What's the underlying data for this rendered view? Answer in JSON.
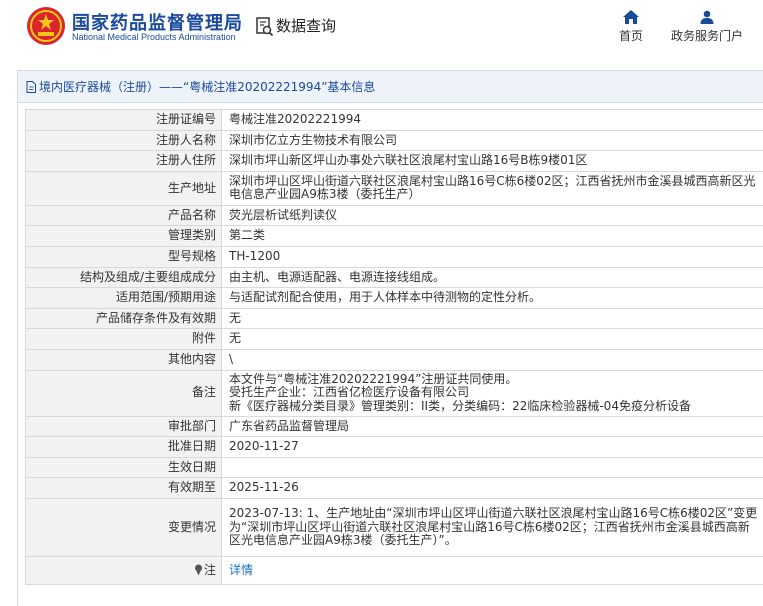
{
  "header": {
    "brand_cn": "国家药品监督管理局",
    "brand_en": "National Medical Products Administration",
    "data_query": "数据查询",
    "nav_home": "首页",
    "nav_portal": "政务服务门户"
  },
  "panel": {
    "title": "境内医疗器械（注册）——“粤械注准20202221994”基本信息"
  },
  "rows": [
    {
      "label": "注册证编号",
      "value": "粤械注准20202221994"
    },
    {
      "label": "注册人名称",
      "value": "深圳市亿立方生物技术有限公司"
    },
    {
      "label": "注册人住所",
      "value": "深圳市坪山新区坪山办事处六联社区浪尾村宝山路16号B栋9楼01区"
    },
    {
      "label": "生产地址",
      "value": "深圳市坪山区坪山街道六联社区浪尾村宝山路16号C栋6楼02区；江西省抚州市金溪县城西高新区光电信息产业园A9栋3楼（委托生产）"
    },
    {
      "label": "产品名称",
      "value": "荧光层析试纸判读仪"
    },
    {
      "label": "管理类别",
      "value": "第二类"
    },
    {
      "label": "型号规格",
      "value": "TH-1200"
    },
    {
      "label": "结构及组成/主要组成成分",
      "value": "由主机、电源适配器、电源连接线组成。"
    },
    {
      "label": "适用范围/预期用途",
      "value": "与适配试剂配合使用，用于人体样本中待测物的定性分析。"
    },
    {
      "label": "产品储存条件及有效期",
      "value": "无"
    },
    {
      "label": "附件",
      "value": "无"
    },
    {
      "label": "其他内容",
      "value": "\\"
    },
    {
      "label": "备注",
      "value_lines": [
        "本文件与“粤械注准20202221994”注册证共同使用。",
        "受托生产企业：江西省亿检医疗设备有限公司",
        "新《医疗器械分类目录》管理类别：II类，分类编码：22临床检验器械-04免疫分析设备"
      ]
    },
    {
      "label": "审批部门",
      "value": "广东省药品监督管理局"
    },
    {
      "label": "批准日期",
      "value": "2020-11-27"
    },
    {
      "label": "生效日期",
      "value": ""
    },
    {
      "label": "有效期至",
      "value": "2025-11-26"
    },
    {
      "label": "变更情况",
      "value": "2023-07-13: 1、生产地址由“深圳市坪山区坪山街道六联社区浪尾村宝山路16号C栋6楼02区”变更为“深圳市坪山区坪山街道六联社区浪尾村宝山路16号C栋6楼02区；江西省抚州市金溪县城西高新区光电信息产业园A9栋3楼（委托生产）”。"
    },
    {
      "label": "注",
      "value": "详情"
    }
  ],
  "colors": {
    "brand_blue": "#1a4a9c",
    "link_blue": "#1a6fc0",
    "label_bg": "#f2f2f2",
    "title_bg": "#eef3fa"
  },
  "icons": {
    "logo": "national-emblem-icon",
    "data_query": "search-document-icon",
    "home": "home-icon",
    "portal": "user-icon",
    "title": "document-icon",
    "note": "pin-icon"
  }
}
